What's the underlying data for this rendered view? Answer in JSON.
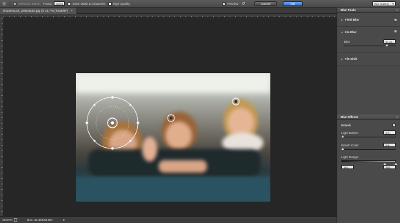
{
  "options_bar": {
    "selection_bleed_label": "Selection Bleed:",
    "focus_label": "Focus:",
    "focus_value": "100%",
    "save_mask_label": "Save Mask to Channels",
    "high_quality_label": "High Quality",
    "preview_label": "Preview",
    "cancel_label": "Cancel",
    "ok_label": "OK",
    "workspace_select": "Blur Gallery"
  },
  "document": {
    "tab_title": "shutterstock_29603536.jpg @ 16.7% (RGB/8#)"
  },
  "status_bar": {
    "zoom": "16.67%",
    "doc_info": "Doc: 32.8M/32.8M"
  },
  "blur_tools": {
    "title": "Blur Tools",
    "items": [
      {
        "label": "Field Blur",
        "checked": true
      },
      {
        "label": "Iris Blur",
        "checked": true
      },
      {
        "label": "Tilt-Shift",
        "checked": false
      }
    ],
    "blur_label": "Blur:",
    "blur_value": "91 px",
    "blur_fraction": 0.8
  },
  "blur_effects": {
    "title": "Blur Effects",
    "bokeh_label": "Bokeh",
    "light_bokeh_label": "Light Bokeh:",
    "light_bokeh_value": "0%",
    "bokeh_color_label": "Bokeh Color:",
    "bokeh_color_value": "0%",
    "light_range_label": "Light Range:",
    "light_range_low": "191",
    "light_range_high": "255"
  },
  "colors": {
    "accent": "#2f6fd6",
    "panel_bg": "#4a4a4a",
    "canvas_bg": "#262626"
  }
}
